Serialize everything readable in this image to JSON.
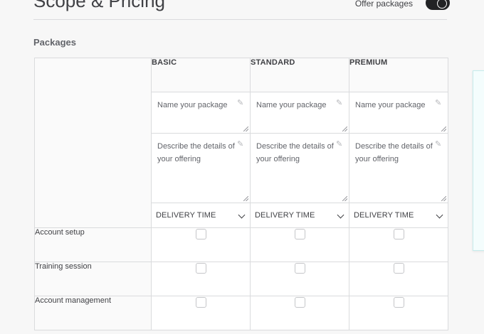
{
  "header": {
    "title": "Scope & Pricing",
    "toggle_label": "Offer packages"
  },
  "section_title": "Packages",
  "packages": [
    {
      "name": "BASIC",
      "name_placeholder": "Name your package",
      "desc_placeholder": "Describe the details of your offering",
      "delivery": "DELIVERY TIME"
    },
    {
      "name": "STANDARD",
      "name_placeholder": "Name your package",
      "desc_placeholder": "Describe the details of your offering",
      "delivery": "DELIVERY TIME"
    },
    {
      "name": "PREMIUM",
      "name_placeholder": "Name your package",
      "desc_placeholder": "Describe the details of your offering",
      "delivery": "DELIVERY TIME"
    }
  ],
  "features": [
    {
      "label": "Account setup",
      "checked": [
        false,
        false,
        false
      ]
    },
    {
      "label": "Training session",
      "checked": [
        false,
        false,
        false
      ]
    },
    {
      "label": "Account management",
      "checked": [
        false,
        false,
        false
      ]
    }
  ],
  "icons": {
    "edit": "pencil-icon",
    "dropdown": "chevron-down-icon"
  }
}
